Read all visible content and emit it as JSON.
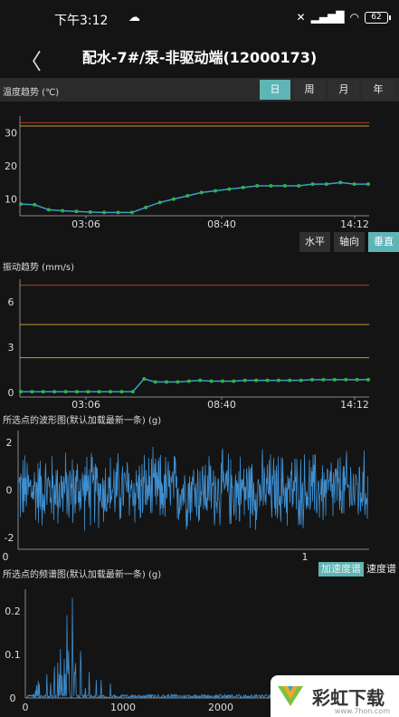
{
  "status_bar": {
    "time": "下午3:12",
    "battery": "62"
  },
  "header": {
    "title": "配水-7#/泵-非驱动端(12000173)"
  },
  "temp_section": {
    "title": "温度趋势 (℃)",
    "periods": [
      "日",
      "周",
      "月",
      "年"
    ],
    "active_period": "日",
    "chart_data": {
      "type": "line",
      "ylim": [
        5,
        35
      ],
      "yticks": [
        "30",
        "20",
        "10"
      ],
      "xticks": [
        "03:06",
        "08:40",
        "14:12"
      ],
      "upper_line_1": 33,
      "upper_line_2": 32,
      "values": [
        8.5,
        8.3,
        6.8,
        6.5,
        6.3,
        6.1,
        6,
        6,
        6,
        7.5,
        9,
        10,
        11,
        12,
        12.5,
        13,
        13.5,
        14,
        14,
        14,
        14,
        14.5,
        14.5,
        15,
        14.5,
        14.5
      ]
    }
  },
  "vib_section": {
    "title": "振动趋势 (mm/s)",
    "axes": [
      "水平",
      "轴向",
      "垂直"
    ],
    "active_axis": "垂直",
    "chart_data": {
      "type": "line",
      "ylim": [
        -0.3,
        7.5
      ],
      "yticks": [
        "6",
        "3",
        "0"
      ],
      "xticks": [
        "03:06",
        "08:40",
        "14:12"
      ],
      "alarm_red": 7.1,
      "alarm_orange": 4.5,
      "alarm_yellow": 2.3,
      "values": [
        0.05,
        0.05,
        0.05,
        0.05,
        0.05,
        0.05,
        0.05,
        0.05,
        0.05,
        0.05,
        0.05,
        0.9,
        0.7,
        0.7,
        0.7,
        0.75,
        0.8,
        0.75,
        0.75,
        0.75,
        0.8,
        0.8,
        0.8,
        0.8,
        0.8,
        0.8,
        0.85,
        0.85,
        0.85,
        0.85,
        0.85,
        0.85
      ]
    }
  },
  "wave_section": {
    "title": "所选点的波形图(默认加载最新一条) (g)",
    "chart_data": {
      "type": "line",
      "yticks": [
        "2",
        "0",
        "-2"
      ],
      "xticks": [
        "0",
        "1"
      ],
      "ylim": [
        -2.5,
        2.5
      ]
    }
  },
  "spectrum_section": {
    "title": "所选点的频谱图(默认加载最新一条) (g)",
    "tabs": [
      "加速度谱",
      "速度谱"
    ],
    "active_tab": "加速度谱",
    "chart_data": {
      "type": "line",
      "yticks": [
        "0.2",
        "0.1",
        "0"
      ],
      "xticks": [
        "0",
        "1000",
        "2000"
      ],
      "ylim": [
        0,
        0.25
      ]
    }
  },
  "watermark": {
    "text": "彩虹下载",
    "url": "www.7hon.com"
  }
}
